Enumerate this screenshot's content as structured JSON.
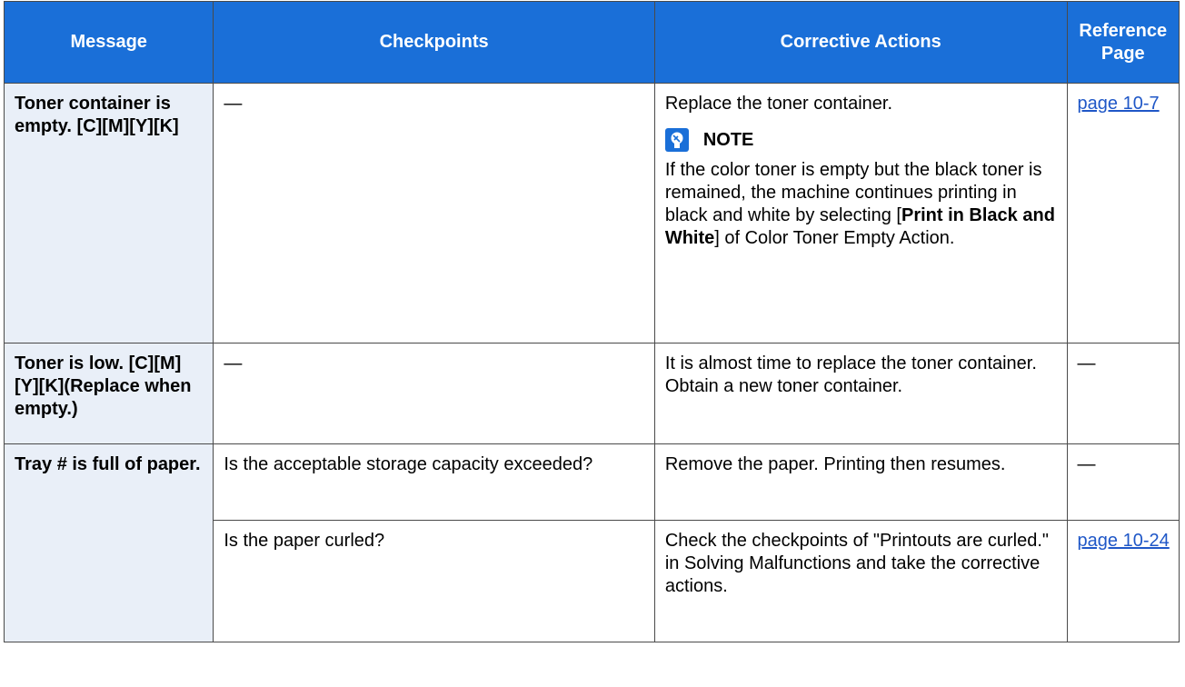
{
  "headers": {
    "message": "Message",
    "checkpoints": "Checkpoints",
    "actions": "Corrective Actions",
    "reference": "Reference Page"
  },
  "rows": [
    {
      "message": "Toner container is empty. [C][M][Y][K]",
      "checkpoint": "—",
      "action": "Replace the toner container.",
      "note": {
        "title": "NOTE",
        "text_before": "If the color toner is empty but the black toner is remained, the machine continues printing in black and white by selecting [",
        "bold": "Print in Black and White",
        "text_after": "] of Color Toner Empty Action."
      },
      "reference": "page 10-7"
    },
    {
      "message": "Toner is low. [C][M][Y][K](Replace when empty.)",
      "checkpoint": "—",
      "action": "It is almost time to replace the toner container. Obtain a new toner container.",
      "reference": "—"
    },
    {
      "message": "Tray # is full of paper.",
      "sub_rows": [
        {
          "checkpoint": "Is the acceptable storage capacity exceeded?",
          "action": "Remove the paper. Printing then resumes.",
          "reference": "—"
        },
        {
          "checkpoint": "Is the paper curled?",
          "action": "Check the checkpoints of \"Printouts are curled.\" in Solving Malfunctions and take the corrective actions.",
          "reference": "page 10-24"
        }
      ]
    }
  ],
  "colors": {
    "header_bg": "#1a6fd8",
    "message_bg": "#e9eff8",
    "link": "#1f57c7"
  },
  "icons": {
    "note": "note-lightbulb-icon"
  }
}
